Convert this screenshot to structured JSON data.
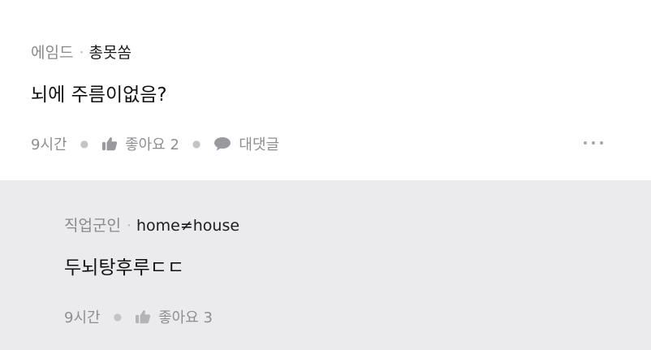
{
  "comment": {
    "company": "에임드",
    "separator": "·",
    "nickname": "총못쏨",
    "text": "뇌에 주름이없음?",
    "time": "9시간",
    "like_label": "좋아요 2",
    "reply_label": "대댓글",
    "like_icon": "thumbs-up-icon",
    "reply_icon": "speech-bubble-icon",
    "more_icon": "more-dots-icon"
  },
  "reply": {
    "company": "직업군인",
    "separator": "·",
    "nickname": "home≠house",
    "text": "두뇌탕후루ㄷㄷ",
    "time": "9시간",
    "like_label": "좋아요 3",
    "like_icon": "thumbs-up-icon"
  },
  "colors": {
    "reply_background": "#ebebed",
    "meta_gray": "#8e8e93",
    "text_dark": "#111111"
  }
}
